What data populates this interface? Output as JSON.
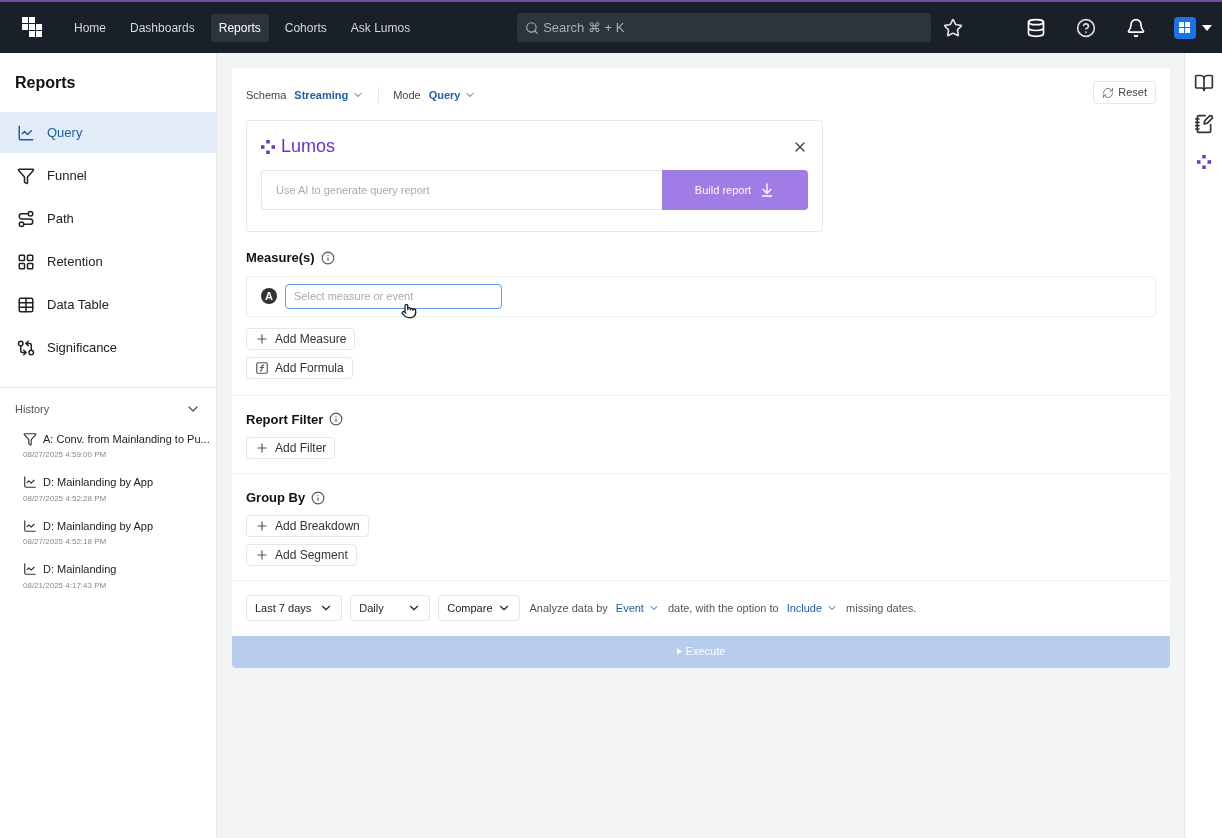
{
  "top_nav": {
    "items": [
      {
        "label": "Home",
        "selected": false
      },
      {
        "label": "Dashboards",
        "selected": false
      },
      {
        "label": "Reports",
        "selected": true
      },
      {
        "label": "Cohorts",
        "selected": false
      },
      {
        "label": "Ask Lumos",
        "selected": false
      }
    ],
    "search": {
      "placeholder": "Search ⌘ + K"
    }
  },
  "sidebar": {
    "title": "Reports",
    "items": [
      {
        "kind": "query",
        "label": "Query",
        "selected": true
      },
      {
        "kind": "funnel",
        "label": "Funnel",
        "selected": false
      },
      {
        "kind": "path",
        "label": "Path",
        "selected": false
      },
      {
        "kind": "retention",
        "label": "Retention",
        "selected": false
      },
      {
        "kind": "table",
        "label": "Data Table",
        "selected": false
      },
      {
        "kind": "significance",
        "label": "Significance",
        "selected": false
      }
    ],
    "history": {
      "title": "History",
      "expanded": true,
      "items": [
        {
          "kind": "funnel",
          "title": "A: Conv. from Mainlanding to Pu...",
          "time": "08/27/2025 4:59:00 PM"
        },
        {
          "kind": "query",
          "title": "D: Mainlanding by App",
          "time": "08/27/2025 4:52:28 PM"
        },
        {
          "kind": "query",
          "title": "D: Mainlanding by App",
          "time": "08/27/2025 4:52:18 PM"
        },
        {
          "kind": "query",
          "title": "D: Mainlanding",
          "time": "08/21/2025 4:17:43 PM"
        }
      ]
    }
  },
  "main": {
    "schema": {
      "label": "Schema",
      "value": "Streaming"
    },
    "mode": {
      "label": "Mode",
      "value": "Query"
    },
    "reset": "Reset",
    "lumos": {
      "title": "Lumos",
      "placeholder": "Use AI to generate query report",
      "button": "Build report",
      "disabled": true
    },
    "measures": {
      "title": "Measure(s)",
      "rows": [
        {
          "letter": "A",
          "placeholder": "Select measure or event"
        }
      ],
      "buttons": [
        {
          "kind": "add",
          "label": "Add Measure"
        },
        {
          "kind": "formula",
          "label": "Add Formula"
        }
      ]
    },
    "report_filter": {
      "title": "Report Filter",
      "buttons": [
        {
          "kind": "add",
          "label": "Add Filter"
        }
      ]
    },
    "group_by": {
      "title": "Group By",
      "buttons": [
        {
          "kind": "add",
          "label": "Add Breakdown"
        },
        {
          "kind": "add",
          "label": "Add Segment"
        }
      ]
    },
    "footer": {
      "range": "Last 7 days",
      "interval": "Daily",
      "compare": "Compare",
      "text_1": "Analyze data by",
      "option_1": "Event",
      "text_2": "date, with the option to",
      "option_2": "Include",
      "text_3": "missing dates."
    },
    "execute": {
      "label": "Execute",
      "disabled": true
    }
  }
}
